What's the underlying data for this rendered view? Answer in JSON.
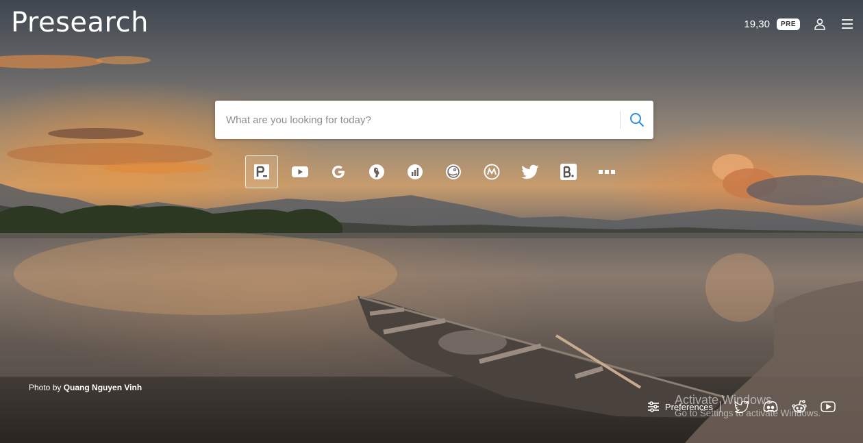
{
  "app": {
    "logo_text": "Presearch"
  },
  "topbar": {
    "balance": "19,30",
    "token_badge": "PRE"
  },
  "search": {
    "placeholder": "What are you looking for today?",
    "value": ""
  },
  "engines": [
    {
      "name": "presearch",
      "glyph": "P_",
      "active": true
    },
    {
      "name": "youtube",
      "glyph": "",
      "active": false
    },
    {
      "name": "google",
      "glyph": "G",
      "active": false
    },
    {
      "name": "duckduckgo",
      "glyph": "",
      "active": false
    },
    {
      "name": "coinmarketcap",
      "glyph": "",
      "active": false
    },
    {
      "name": "coingecko",
      "glyph": "",
      "active": false
    },
    {
      "name": "coinmarket-alt",
      "glyph": "",
      "active": false
    },
    {
      "name": "twitter",
      "glyph": "",
      "active": false
    },
    {
      "name": "booking",
      "glyph": "B.",
      "active": false
    },
    {
      "name": "more",
      "glyph": "",
      "active": false
    }
  ],
  "credit": {
    "prefix": "Photo by",
    "author": "Quang Nguyen Vinh"
  },
  "footer": {
    "preferences_label": "Preferences",
    "socials": [
      "twitter-icon",
      "discord-icon",
      "reddit-icon",
      "youtube-icon"
    ]
  },
  "watermark": {
    "title": "Activate Windows",
    "subtitle": "Go to Settings to activate Windows."
  },
  "colors": {
    "search_icon": "#2d8ae5",
    "text_light": "#ffffff"
  }
}
